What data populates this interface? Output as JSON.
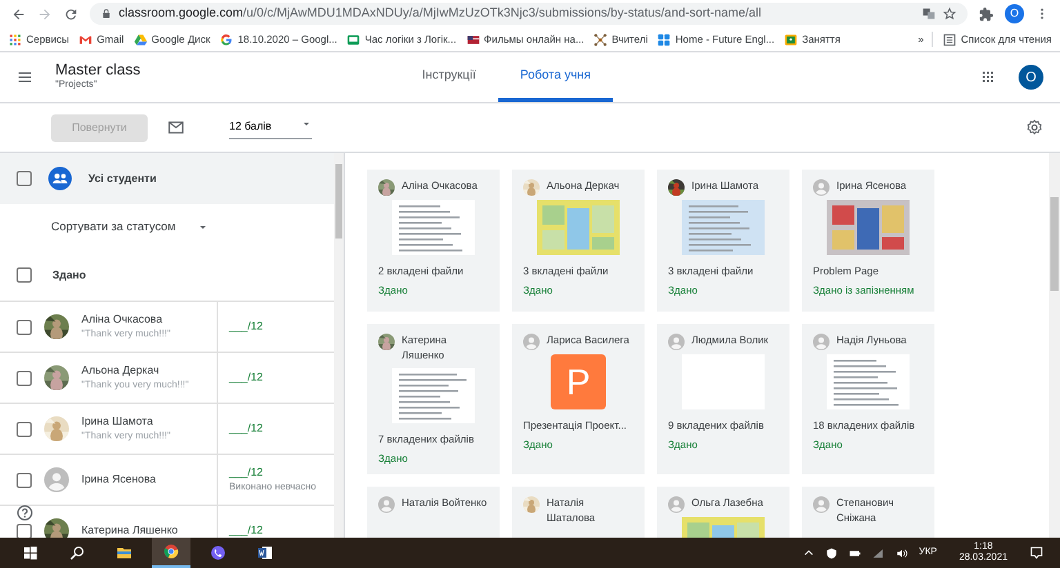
{
  "browser": {
    "url_host": "classroom.google.com",
    "url_path": "/u/0/c/MjAwMDU1MDAxNDUy/a/MjIwMzUzOTk3Njc3/submissions/by-status/and-sort-name/all",
    "profile": "O"
  },
  "bookmarks": [
    {
      "label": "Сервисы",
      "kind": "apps"
    },
    {
      "label": "Gmail",
      "kind": "gmail"
    },
    {
      "label": "Google Диск",
      "kind": "drive"
    },
    {
      "label": "18.10.2020 – Googl...",
      "kind": "google"
    },
    {
      "label": "Час логіки з Логік...",
      "kind": "board"
    },
    {
      "label": "Фильмы онлайн на...",
      "kind": "flag"
    },
    {
      "label": "Вчителі",
      "kind": "network"
    },
    {
      "label": "Home - Future Engl...",
      "kind": "tiles"
    },
    {
      "label": "Заняття",
      "kind": "classroom"
    }
  ],
  "bookmarks_more": "»",
  "reading_list": "Список для чтения",
  "header": {
    "course": "Master class",
    "assignment": "\"Projects\"",
    "avatar": "O",
    "tabs": [
      {
        "label": "Інструкції",
        "selected": false
      },
      {
        "label": "Робота учня",
        "selected": true
      }
    ]
  },
  "toolbar": {
    "return_button": {
      "label": "Повернути",
      "disabled": true
    },
    "points": "12 балів"
  },
  "roster": {
    "all_label": "Усі студенти",
    "all_checked": false,
    "sort_label": "Сортувати за статусом",
    "group_label": "Здано",
    "group_checked": false,
    "students": [
      {
        "name": "Аліна Очкасова",
        "comment": "\"Thank very much!!!\"",
        "grade": "___/12",
        "checked": false
      },
      {
        "name": "Альона Деркач",
        "comment": "\"Thank you very much!!!\"",
        "grade": "___/12",
        "checked": false
      },
      {
        "name": "Ірина Шамота",
        "comment": "\"Thank very much!!!\"",
        "grade": "___/12",
        "checked": false
      },
      {
        "name": "Ірина Ясенова",
        "grade": "___/12",
        "note": "Виконано невчасно",
        "avatar": {
          "kind": "default"
        },
        "checked": false
      },
      {
        "name": "Катерина Ляшенко",
        "grade": "___/12",
        "checked": false
      }
    ]
  },
  "cards": [
    {
      "name": "Аліна Очкасова",
      "thumbnail": {
        "kind": "doc"
      },
      "attachment": "2 вкладені файли",
      "status": "Здано"
    },
    {
      "name": "Альона Деркач",
      "attachment": "3 вкладені файли",
      "status": "Здано"
    },
    {
      "name": "Ірина Шамота",
      "thumbnail": {
        "kind": "doc-blue"
      },
      "attachment": "3 вкладені файли",
      "status": "Здано"
    },
    {
      "name": "Ірина Ясенова",
      "avatar": {
        "kind": "default"
      },
      "attachment": "Problem Page",
      "status": "Здано із запізненням"
    },
    {
      "name": "Катерина Ляшенко",
      "thumbnail": {
        "kind": "doc"
      },
      "attachment": "7 вкладених файлів",
      "status": "Здано"
    },
    {
      "name": "Лариса Василега",
      "avatar": {
        "kind": "default"
      },
      "thumbnail": {
        "kind": "slides",
        "letter": "P"
      },
      "attachment": "Презентація Проект...",
      "status": "Здано"
    },
    {
      "name": "Людмила Волик",
      "avatar": {
        "kind": "default"
      },
      "thumbnail": {
        "kind": "blank"
      },
      "attachment": "9 вкладених файлів",
      "status": "Здано"
    },
    {
      "name": "Надія Луньова",
      "avatar": {
        "kind": "default"
      },
      "thumbnail": {
        "kind": "doc"
      },
      "attachment": "18 вкладених файлів",
      "status": "Здано"
    },
    {
      "name": "Наталія Войтенко",
      "avatar": {
        "kind": "default"
      }
    },
    {
      "name": "Наталія Шаталова"
    },
    {
      "name": "Ольга Лазебна",
      "avatar": {
        "kind": "default"
      }
    },
    {
      "name": "Степанович Сніжана",
      "avatar": {
        "kind": "default"
      }
    }
  ],
  "taskbar": {
    "apps": [
      {
        "kind": "start",
        "active": false
      },
      {
        "kind": "search",
        "active": false
      },
      {
        "kind": "folder",
        "active": false
      },
      {
        "kind": "chrome",
        "active": true
      },
      {
        "kind": "viber",
        "active": false
      },
      {
        "kind": "word",
        "active": false
      }
    ],
    "language": "УКР",
    "time": "1:18",
    "date": "28.03.2021"
  }
}
